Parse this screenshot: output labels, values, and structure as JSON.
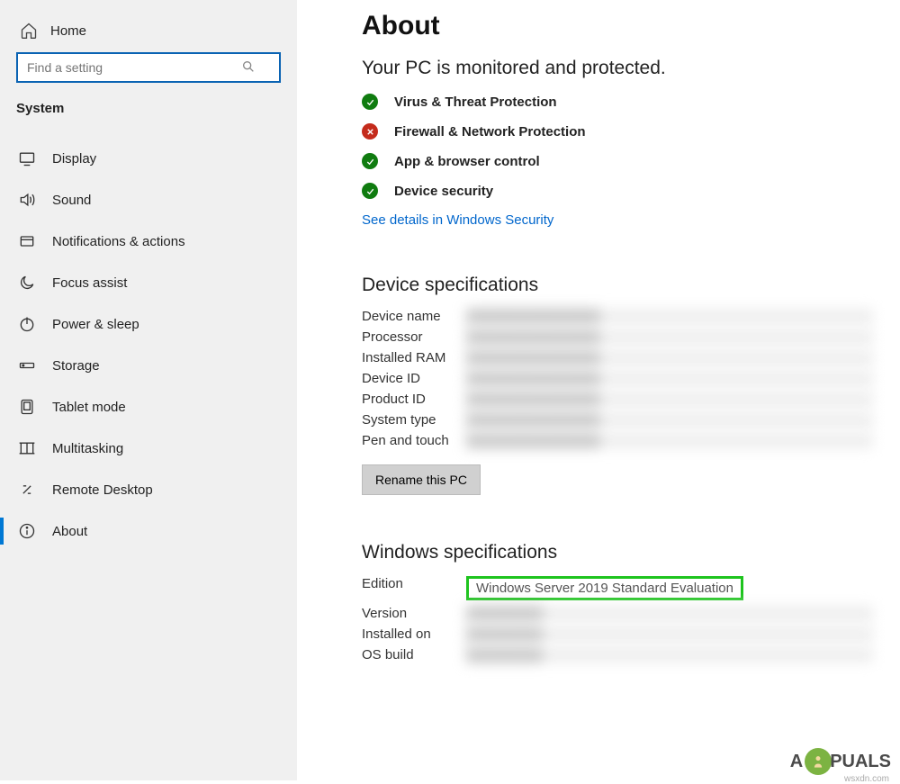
{
  "sidebar": {
    "home_label": "Home",
    "search_placeholder": "Find a setting",
    "category_header": "System",
    "items": [
      {
        "label": "Display",
        "icon": "display"
      },
      {
        "label": "Sound",
        "icon": "sound"
      },
      {
        "label": "Notifications & actions",
        "icon": "notifications"
      },
      {
        "label": "Focus assist",
        "icon": "moon"
      },
      {
        "label": "Power & sleep",
        "icon": "power"
      },
      {
        "label": "Storage",
        "icon": "storage"
      },
      {
        "label": "Tablet mode",
        "icon": "tablet"
      },
      {
        "label": "Multitasking",
        "icon": "multitask"
      },
      {
        "label": "Remote Desktop",
        "icon": "remote"
      },
      {
        "label": "About",
        "icon": "info",
        "selected": true
      }
    ]
  },
  "main": {
    "title": "About",
    "protection": {
      "subtitle": "Your PC is monitored and protected.",
      "items": [
        {
          "label": "Virus & Threat Protection",
          "status": "ok"
        },
        {
          "label": "Firewall & Network Protection",
          "status": "err"
        },
        {
          "label": "App & browser control",
          "status": "ok"
        },
        {
          "label": "Device security",
          "status": "ok"
        }
      ],
      "link": "See details in Windows Security"
    },
    "device_specs": {
      "title": "Device specifications",
      "rows": [
        {
          "label": "Device name"
        },
        {
          "label": "Processor"
        },
        {
          "label": "Installed RAM"
        },
        {
          "label": "Device ID"
        },
        {
          "label": "Product ID"
        },
        {
          "label": "System type"
        },
        {
          "label": "Pen and touch"
        }
      ],
      "rename_button": "Rename this PC"
    },
    "windows_specs": {
      "title": "Windows specifications",
      "edition_label": "Edition",
      "edition_value": "Windows Server 2019 Standard Evaluation",
      "rows": [
        {
          "label": "Version"
        },
        {
          "label": "Installed on"
        },
        {
          "label": "OS build"
        }
      ]
    }
  },
  "watermark": {
    "text_a": "A",
    "text_b": "PUALS",
    "sub": "wsxdn.com"
  }
}
